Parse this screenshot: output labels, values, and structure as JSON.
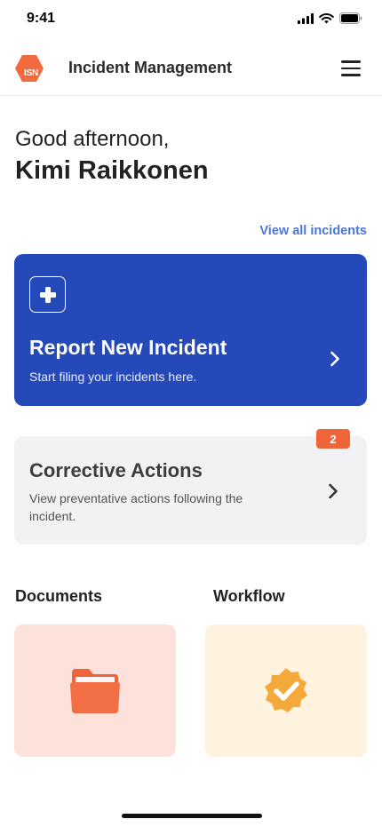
{
  "status_bar": {
    "time": "9:41"
  },
  "header": {
    "logo_text": "ISN",
    "title": "Incident Management",
    "menu_icon": "hamburger-menu-icon"
  },
  "greeting": {
    "salutation": "Good afternoon,",
    "name": "Kimi Raikkonen"
  },
  "incidents": {
    "view_all_label": "View all incidents"
  },
  "report_card": {
    "title": "Report New Incident",
    "subtitle": "Start filing your incidents here.",
    "icon": "plus-icon",
    "color": "#2549b8"
  },
  "corrective_card": {
    "title": "Corrective Actions",
    "description": "View preventative actions following the incident.",
    "badge_count": "2",
    "badge_color": "#f0643a"
  },
  "tiles": [
    {
      "label": "Documents",
      "icon": "folder-icon",
      "color": "#fde2db"
    },
    {
      "label": "Workflow",
      "icon": "verified-badge-icon",
      "color": "#fff3df"
    }
  ]
}
